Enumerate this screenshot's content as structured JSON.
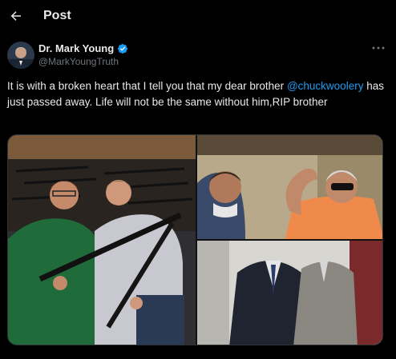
{
  "topbar": {
    "title": "Post",
    "back_icon": "arrow-left-icon"
  },
  "author": {
    "display_name": "Dr. Mark Young",
    "handle": "@MarkYoungTruth",
    "verified_color": "#1d9bf0"
  },
  "tweet": {
    "text_part1": "It is with a broken heart that I tell you that my dear brother",
    "mention": "@chuckwoolery",
    "text_part2": " has just passed away. Life will not be the same without him,RIP brother"
  },
  "colors": {
    "background": "#000000",
    "text": "#e7e9ea",
    "secondary": "#71767b",
    "link": "#1d9bf0"
  },
  "media": {
    "count": 3
  }
}
